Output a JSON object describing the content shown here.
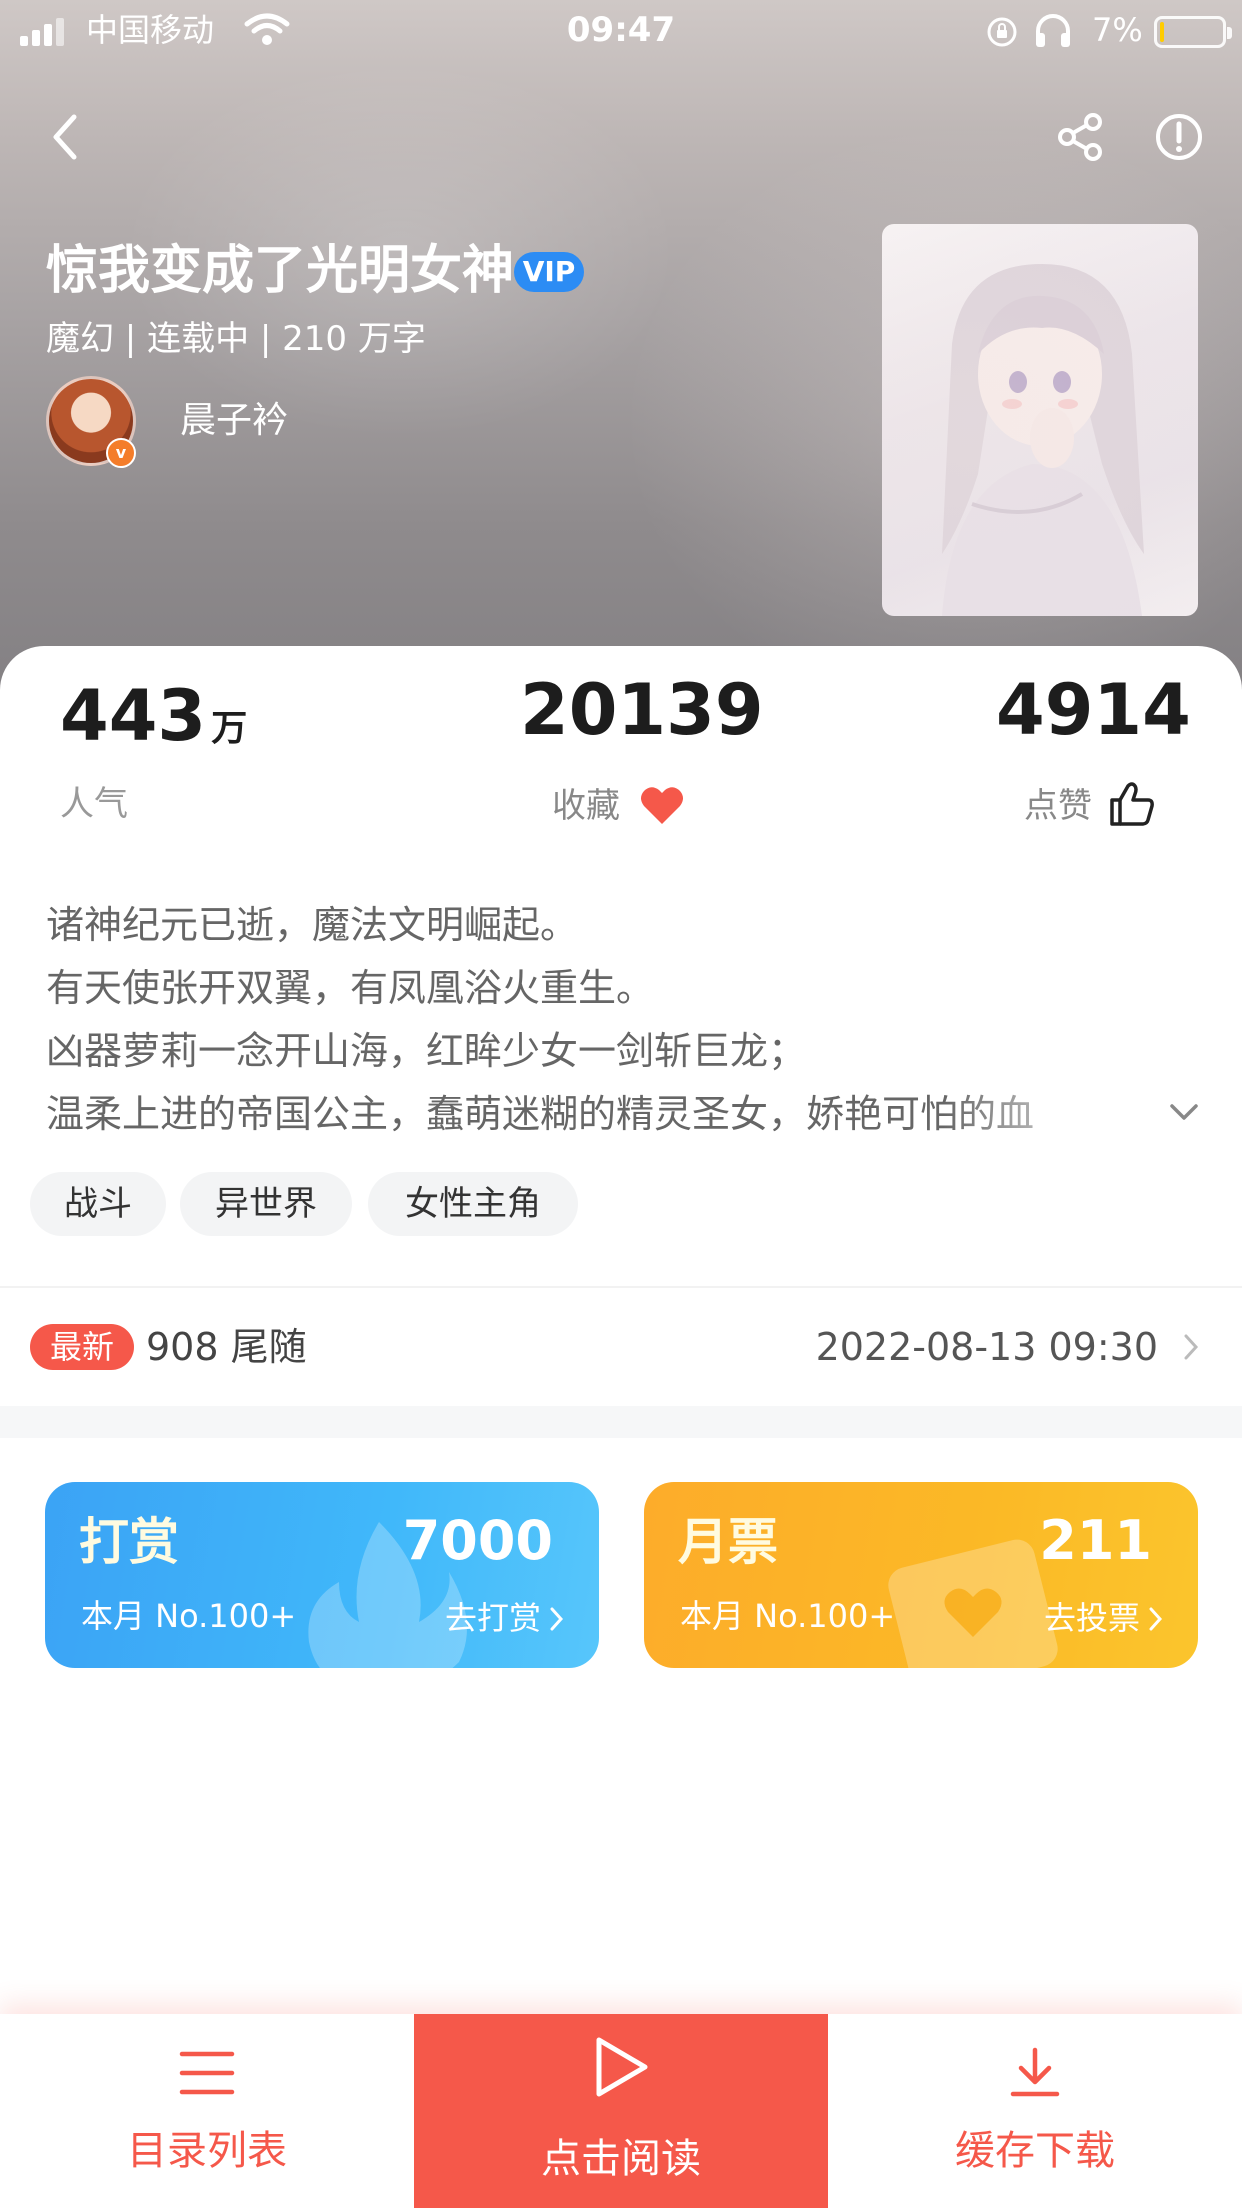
{
  "status_bar": {
    "carrier": "中国移动",
    "time": "09:47",
    "battery": "7%",
    "battery_level": 0.07
  },
  "nav": {
    "back_icon": "chevron-left-icon",
    "share_icon": "share-icon",
    "report_icon": "exclamation-circle-icon"
  },
  "book": {
    "title": "惊我变成了光明女神",
    "vip": "VIP",
    "meta": "魔幻 | 连载中 | 210 万字",
    "author": "晨子衿",
    "author_badge": "v"
  },
  "stats": {
    "popularity_value": "443",
    "popularity_unit": "万",
    "popularity_label": "人气",
    "favorites_value": "20139",
    "favorites_label": "收藏",
    "likes_value": "4914",
    "likes_label": "点赞"
  },
  "synopsis": [
    "诸神纪元已逝，魔法文明崛起。",
    "有天使张开双翼，有凤凰浴火重生。",
    "凶器萝莉一念开山海，红眸少女一剑斩巨龙；",
    "温柔上进的帝国公主，蠢萌迷糊的精灵圣女，娇艳可怕的血"
  ],
  "tags": [
    "战斗",
    "异世界",
    "女性主角"
  ],
  "latest": {
    "badge": "最新",
    "chapter": "908 尾随",
    "time": "2022-08-13 09:30"
  },
  "tip_card": {
    "title": "打赏",
    "value": "7000",
    "rank": "本月 No.100+",
    "action": "去打赏"
  },
  "ticket_card": {
    "title": "月票",
    "value": "211",
    "rank": "本月 No.100+",
    "action": "去投票"
  },
  "bottom_bar": {
    "catalog": "目录列表",
    "read": "点击阅读",
    "download": "缓存下载"
  },
  "colors": {
    "accent": "#f5584a",
    "vip": "#2c8cf4",
    "tip_card": "#3ba3f5",
    "ticket_card": "#fdac2a"
  }
}
